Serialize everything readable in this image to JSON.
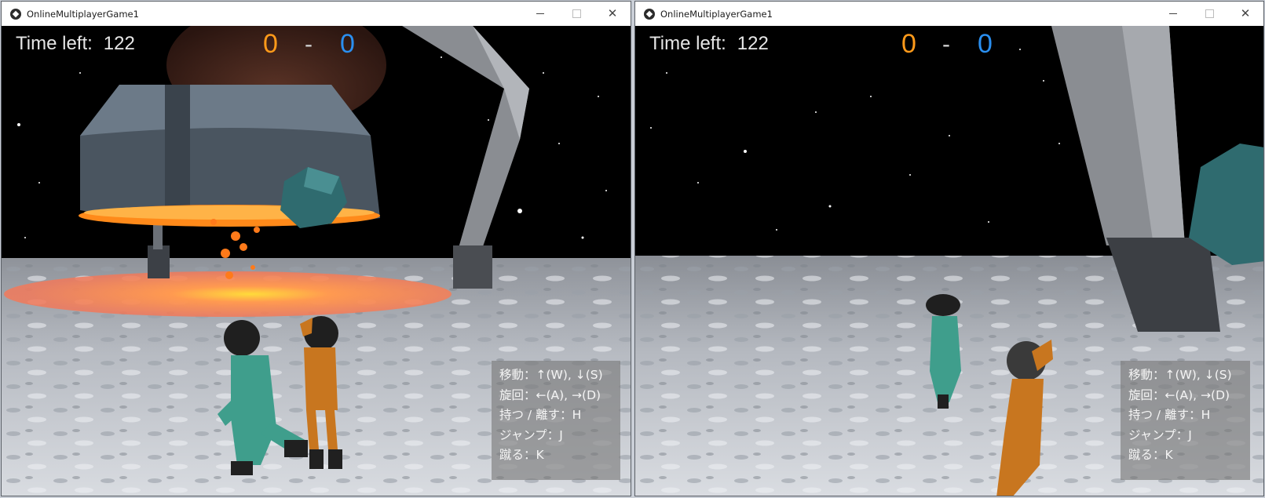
{
  "windows": [
    {
      "title": "OnlineMultiplayerGame1",
      "hud": {
        "time_label": "Time left:",
        "time_value": "122",
        "score_orange": "0",
        "score_separator": "-",
        "score_blue": "0"
      },
      "controls_help": [
        "移動：↑(W), ↓(S)",
        "旋回：←(A), →(D)",
        "持つ / 離す：H",
        "ジャンプ：J",
        "蹴る：K"
      ]
    },
    {
      "title": "OnlineMultiplayerGame1",
      "hud": {
        "time_label": "Time left:",
        "time_value": "122",
        "score_orange": "0",
        "score_separator": "-",
        "score_blue": "0"
      },
      "controls_help": [
        "移動：↑(W), ↓(S)",
        "旋回：←(A), →(D)",
        "持つ / 離す：H",
        "ジャンプ：J",
        "蹴る：K"
      ]
    }
  ],
  "colors": {
    "team_orange": "#ff9a1a",
    "team_blue": "#2a8ff0",
    "character_teal": "#3f9e8c",
    "character_orange": "#c8761f"
  },
  "icons": {
    "app": "unity-app-icon",
    "minimize": "minimize-icon",
    "maximize": "maximize-icon",
    "close": "close-icon"
  }
}
